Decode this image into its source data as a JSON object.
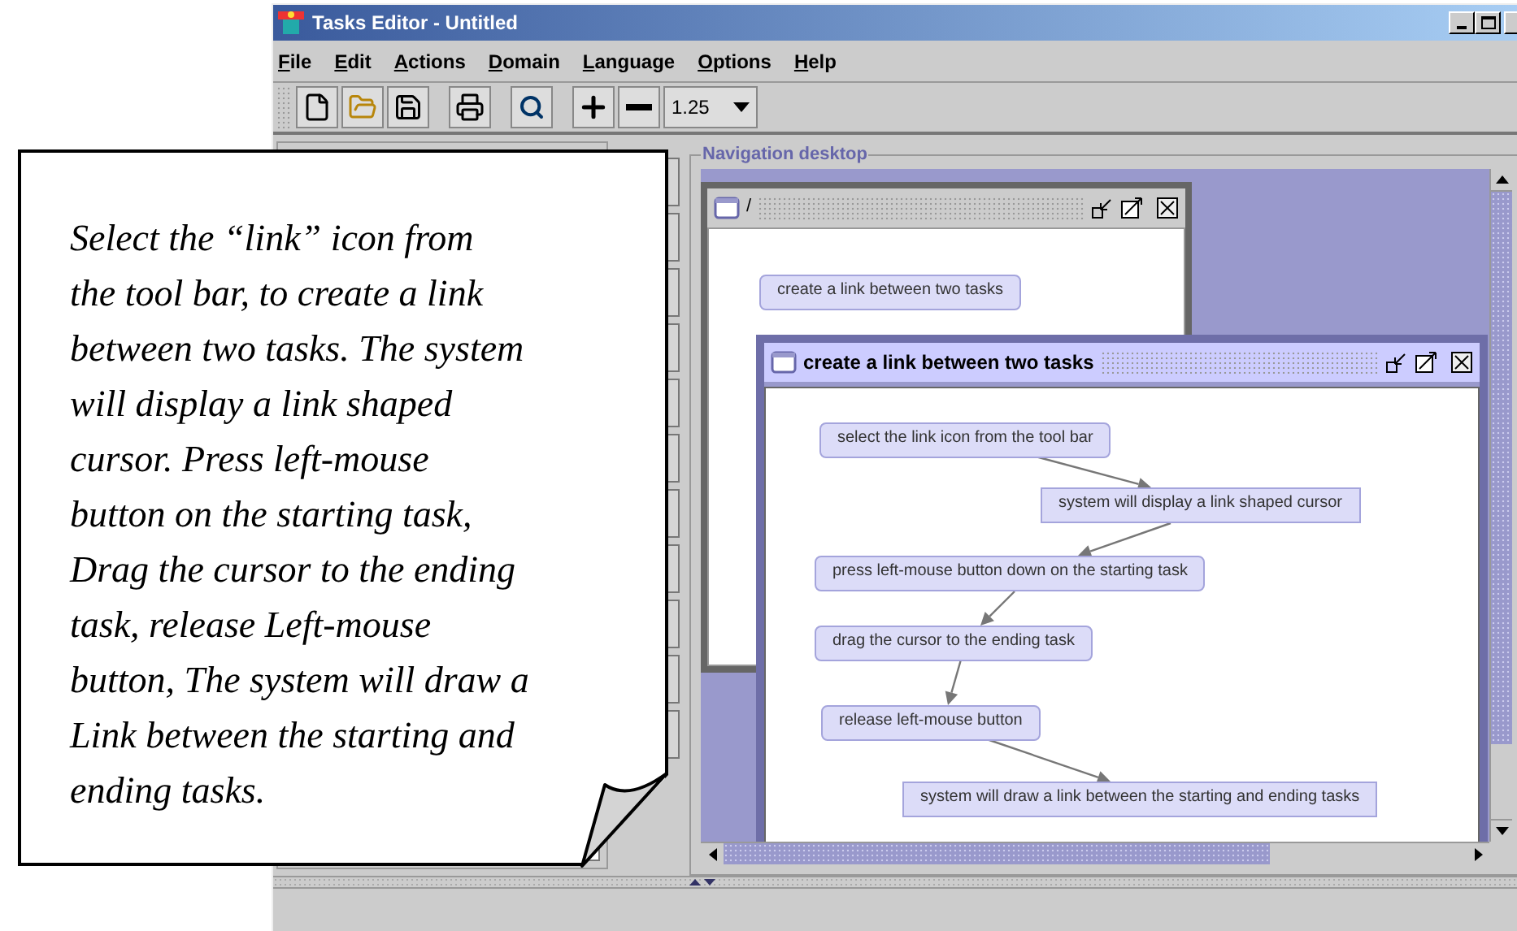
{
  "window": {
    "title": "Tasks Editor - Untitled"
  },
  "menu": [
    {
      "label": "File"
    },
    {
      "label": "Edit"
    },
    {
      "label": "Actions"
    },
    {
      "label": "Domain"
    },
    {
      "label": "Language"
    },
    {
      "label": "Options"
    },
    {
      "label": "Help"
    }
  ],
  "toolbar": {
    "zoom": "1.25"
  },
  "navigation": {
    "title": "Navigation desktop",
    "frames": [
      {
        "title": "/",
        "nodes": [
          {
            "label": "create a link between two tasks",
            "kind": "user"
          }
        ]
      },
      {
        "title": "create a link between two tasks",
        "nodes": [
          {
            "label": "select the link icon from the tool bar",
            "kind": "user"
          },
          {
            "label": "system will display a link shaped cursor",
            "kind": "system"
          },
          {
            "label": "press left-mouse button down on the starting task",
            "kind": "user"
          },
          {
            "label": "drag the cursor to the ending task",
            "kind": "user"
          },
          {
            "label": "release left-mouse button",
            "kind": "user"
          },
          {
            "label": "system will draw a link between the starting and ending tasks",
            "kind": "system"
          }
        ]
      }
    ]
  },
  "callout": {
    "text": "Select the “link” icon from\nthe tool bar, to create a link\nbetween two tasks. The system\nwill display a link shaped\ncursor. Press left-mouse\nbutton on the starting task,\nDrag the cursor to the ending\ntask, release Left-mouse\nbutton, The system will draw a\nLink between the starting and\nending tasks."
  }
}
